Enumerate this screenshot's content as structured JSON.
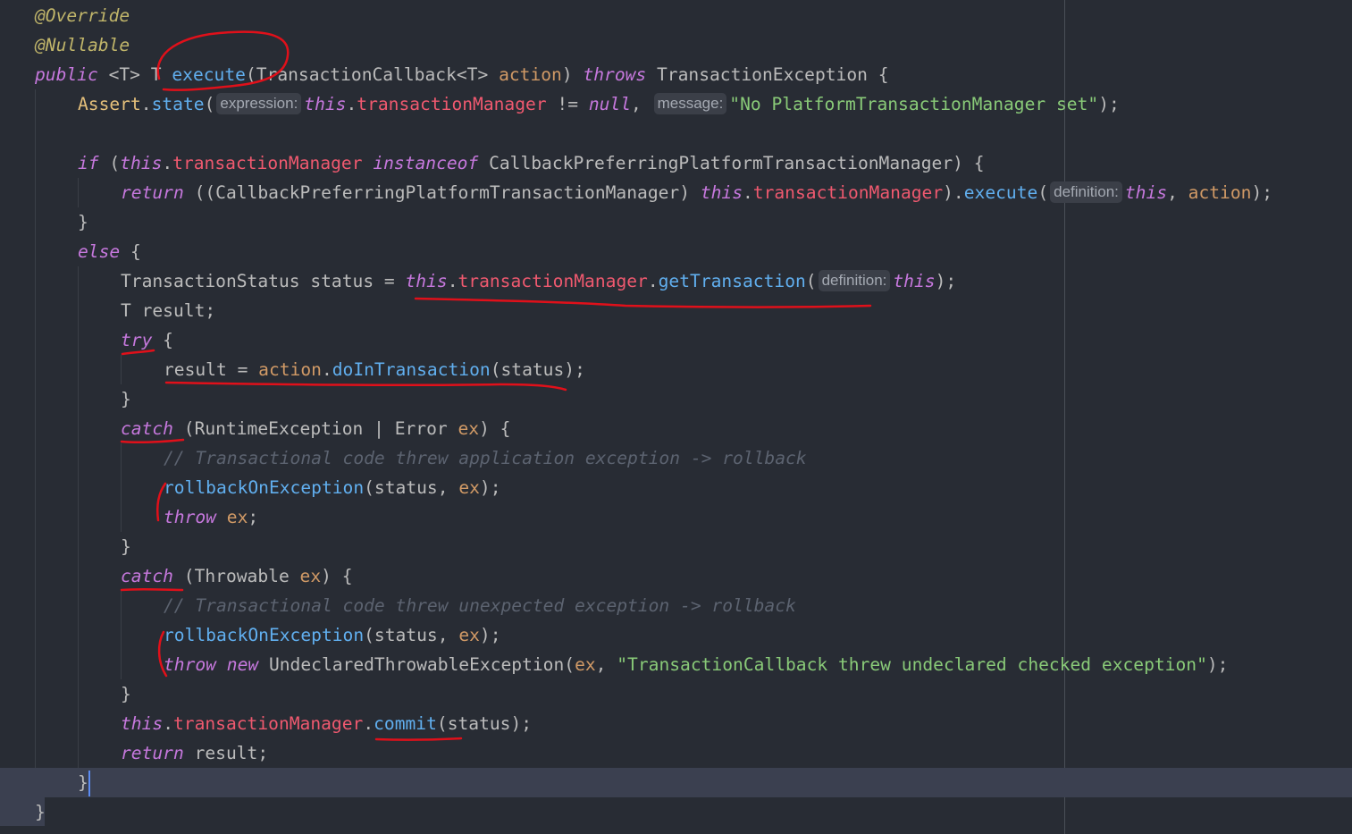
{
  "colors": {
    "background": "#282c34",
    "annotation": "#e0101a",
    "caret": "#5c8cf2",
    "current_line": "#3b4050"
  },
  "code_lines": [
    {
      "indent": 0,
      "tokens": [
        {
          "t": "@Override",
          "s": "ann"
        }
      ]
    },
    {
      "indent": 0,
      "tokens": [
        {
          "t": "@Nullable",
          "s": "ann"
        }
      ]
    },
    {
      "indent": 0,
      "tokens": [
        {
          "t": "public",
          "s": "kw"
        },
        {
          "t": " <T> T ",
          "s": "plain"
        },
        {
          "t": "execute",
          "s": "fn"
        },
        {
          "t": "(TransactionCallback<T> ",
          "s": "plain"
        },
        {
          "t": "action",
          "s": "param"
        },
        {
          "t": ") ",
          "s": "plain"
        },
        {
          "t": "throws",
          "s": "kw"
        },
        {
          "t": " TransactionException {",
          "s": "plain"
        }
      ]
    },
    {
      "indent": 1,
      "tokens": [
        {
          "t": "Assert",
          "s": "type"
        },
        {
          "t": ".",
          "s": "plain"
        },
        {
          "t": "state",
          "s": "fn"
        },
        {
          "t": "(",
          "s": "plain"
        },
        {
          "t": "expression:",
          "s": "hint"
        },
        {
          "t": "this",
          "s": "kw"
        },
        {
          "t": ".",
          "s": "plain"
        },
        {
          "t": "transactionManager",
          "s": "field"
        },
        {
          "t": " != ",
          "s": "plain"
        },
        {
          "t": "null",
          "s": "kw"
        },
        {
          "t": ", ",
          "s": "plain"
        },
        {
          "t": "message:",
          "s": "hint"
        },
        {
          "t": "\"No PlatformTransactionManager set\"",
          "s": "str"
        },
        {
          "t": ");",
          "s": "plain"
        }
      ]
    },
    {
      "indent": 1,
      "tokens": []
    },
    {
      "indent": 1,
      "tokens": [
        {
          "t": "if",
          "s": "kw"
        },
        {
          "t": " (",
          "s": "plain"
        },
        {
          "t": "this",
          "s": "kw"
        },
        {
          "t": ".",
          "s": "plain"
        },
        {
          "t": "transactionManager",
          "s": "field"
        },
        {
          "t": " ",
          "s": "plain"
        },
        {
          "t": "instanceof",
          "s": "kw"
        },
        {
          "t": " CallbackPreferringPlatformTransactionManager) {",
          "s": "plain"
        }
      ]
    },
    {
      "indent": 2,
      "tokens": [
        {
          "t": "return",
          "s": "kw"
        },
        {
          "t": " ((CallbackPreferringPlatformTransactionManager) ",
          "s": "plain"
        },
        {
          "t": "this",
          "s": "kw"
        },
        {
          "t": ".",
          "s": "plain"
        },
        {
          "t": "transactionManager",
          "s": "field"
        },
        {
          "t": ").",
          "s": "plain"
        },
        {
          "t": "execute",
          "s": "fn"
        },
        {
          "t": "(",
          "s": "plain"
        },
        {
          "t": "definition:",
          "s": "hint"
        },
        {
          "t": "this",
          "s": "kw"
        },
        {
          "t": ", ",
          "s": "plain"
        },
        {
          "t": "action",
          "s": "param"
        },
        {
          "t": ");",
          "s": "plain"
        }
      ]
    },
    {
      "indent": 1,
      "tokens": [
        {
          "t": "}",
          "s": "plain"
        }
      ]
    },
    {
      "indent": 1,
      "tokens": [
        {
          "t": "else",
          "s": "kw"
        },
        {
          "t": " {",
          "s": "plain"
        }
      ]
    },
    {
      "indent": 2,
      "tokens": [
        {
          "t": "TransactionStatus status = ",
          "s": "plain"
        },
        {
          "t": "this",
          "s": "kw"
        },
        {
          "t": ".",
          "s": "plain"
        },
        {
          "t": "transactionManager",
          "s": "field"
        },
        {
          "t": ".",
          "s": "plain"
        },
        {
          "t": "getTransaction",
          "s": "fn"
        },
        {
          "t": "(",
          "s": "plain"
        },
        {
          "t": "definition:",
          "s": "hint"
        },
        {
          "t": "this",
          "s": "kw"
        },
        {
          "t": ");",
          "s": "plain"
        }
      ]
    },
    {
      "indent": 2,
      "tokens": [
        {
          "t": "T result;",
          "s": "plain"
        }
      ]
    },
    {
      "indent": 2,
      "tokens": [
        {
          "t": "try",
          "s": "kw"
        },
        {
          "t": " {",
          "s": "plain"
        }
      ]
    },
    {
      "indent": 3,
      "tokens": [
        {
          "t": "result = ",
          "s": "plain"
        },
        {
          "t": "action",
          "s": "param"
        },
        {
          "t": ".",
          "s": "plain"
        },
        {
          "t": "doInTransaction",
          "s": "fn"
        },
        {
          "t": "(status);",
          "s": "plain"
        }
      ]
    },
    {
      "indent": 2,
      "tokens": [
        {
          "t": "}",
          "s": "plain"
        }
      ]
    },
    {
      "indent": 2,
      "tokens": [
        {
          "t": "catch",
          "s": "kw"
        },
        {
          "t": " (RuntimeException | Error ",
          "s": "plain"
        },
        {
          "t": "ex",
          "s": "param"
        },
        {
          "t": ") {",
          "s": "plain"
        }
      ]
    },
    {
      "indent": 3,
      "tokens": [
        {
          "t": "// Transactional code threw application exception -> rollback",
          "s": "cmt"
        }
      ]
    },
    {
      "indent": 3,
      "tokens": [
        {
          "t": "rollbackOnException",
          "s": "fn"
        },
        {
          "t": "(status, ",
          "s": "plain"
        },
        {
          "t": "ex",
          "s": "param"
        },
        {
          "t": ");",
          "s": "plain"
        }
      ]
    },
    {
      "indent": 3,
      "tokens": [
        {
          "t": "throw",
          "s": "kw"
        },
        {
          "t": " ",
          "s": "plain"
        },
        {
          "t": "ex",
          "s": "param"
        },
        {
          "t": ";",
          "s": "plain"
        }
      ]
    },
    {
      "indent": 2,
      "tokens": [
        {
          "t": "}",
          "s": "plain"
        }
      ]
    },
    {
      "indent": 2,
      "tokens": [
        {
          "t": "catch",
          "s": "kw"
        },
        {
          "t": " (Throwable ",
          "s": "plain"
        },
        {
          "t": "ex",
          "s": "param"
        },
        {
          "t": ") {",
          "s": "plain"
        }
      ]
    },
    {
      "indent": 3,
      "tokens": [
        {
          "t": "// Transactional code threw unexpected exception -> rollback",
          "s": "cmt"
        }
      ]
    },
    {
      "indent": 3,
      "tokens": [
        {
          "t": "rollbackOnException",
          "s": "fn"
        },
        {
          "t": "(status, ",
          "s": "plain"
        },
        {
          "t": "ex",
          "s": "param"
        },
        {
          "t": ");",
          "s": "plain"
        }
      ]
    },
    {
      "indent": 3,
      "tokens": [
        {
          "t": "throw",
          "s": "kw"
        },
        {
          "t": " ",
          "s": "plain"
        },
        {
          "t": "new",
          "s": "kw"
        },
        {
          "t": " UndeclaredThrowableException(",
          "s": "plain"
        },
        {
          "t": "ex",
          "s": "param"
        },
        {
          "t": ", ",
          "s": "plain"
        },
        {
          "t": "\"TransactionCallback threw undeclared checked exception\"",
          "s": "str"
        },
        {
          "t": ");",
          "s": "plain"
        }
      ]
    },
    {
      "indent": 2,
      "tokens": [
        {
          "t": "}",
          "s": "plain"
        }
      ]
    },
    {
      "indent": 2,
      "tokens": [
        {
          "t": "this",
          "s": "kw"
        },
        {
          "t": ".",
          "s": "plain"
        },
        {
          "t": "transactionManager",
          "s": "field"
        },
        {
          "t": ".",
          "s": "plain"
        },
        {
          "t": "commit",
          "s": "fn"
        },
        {
          "t": "(status);",
          "s": "plain"
        }
      ]
    },
    {
      "indent": 2,
      "tokens": [
        {
          "t": "return",
          "s": "kw"
        },
        {
          "t": " result;",
          "s": "plain"
        }
      ]
    },
    {
      "indent": 1,
      "tokens": [
        {
          "t": "}",
          "s": "plain"
        }
      ],
      "current": true
    },
    {
      "indent": 0,
      "tokens": [
        {
          "t": "}",
          "s": "plain"
        }
      ]
    }
  ],
  "syntax_colors": {
    "ann": "#c0b56a",
    "kw": "#c678dd",
    "fn": "#61afef",
    "param": "#d19a66",
    "field": "#ef596f",
    "str": "#89ca78",
    "cmt": "#5c6370",
    "type": "#e5c07b",
    "plain": "#bbbbbb"
  }
}
